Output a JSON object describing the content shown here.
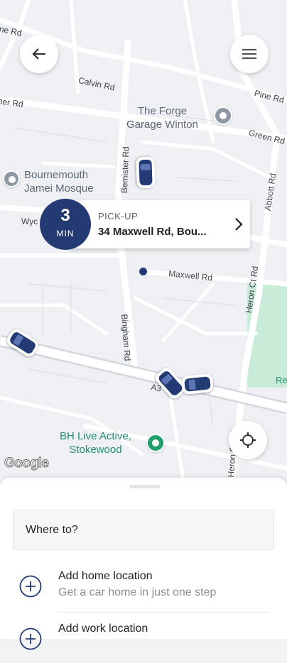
{
  "map": {
    "roads": {
      "pine_rd_top": "ine Rd",
      "calvin_rd": "Calvin Rd",
      "pine_rd_right": "Pine Rd",
      "her_rd": "her Rd",
      "green_rd": "Green Rd",
      "bemister_rd": "Bemister Rd",
      "abbott_rd": "Abbott Rd",
      "wyc": "Wyc",
      "maxwell_rd": "Maxwell Rd",
      "heron_ct_rd": "Heron Ct Rd",
      "bingham_rd": "Bingham Rd",
      "a3": "A3",
      "heron_ct_rd_lower": "Heron Ct Rd",
      "re": "Re"
    },
    "pois": {
      "forge": "The Forge\nGarage Winton",
      "mosque": "Bournemouth\nJamei Mosque",
      "bh_live": "BH Live Active,\nStokewood"
    },
    "google_logo": "Google",
    "pickup": {
      "eta_number": "3",
      "eta_unit": "MIN",
      "label": "PICK-UP",
      "address": "34 Maxwell Rd, Bou..."
    }
  },
  "icons": {
    "back": "arrow-left-icon",
    "menu": "hamburger-menu-icon",
    "locate": "crosshair-icon",
    "chevron": "chevron-right-icon",
    "add": "plus-circle-icon"
  },
  "colors": {
    "brand_navy": "#243a73",
    "park_green": "#c9ecd9",
    "poi_green": "#22a06b"
  },
  "sheet": {
    "search_placeholder": "Where to?",
    "rows": [
      {
        "title": "Add home location",
        "subtitle": "Get a car home in just one step"
      },
      {
        "title": "Add work location"
      }
    ]
  }
}
